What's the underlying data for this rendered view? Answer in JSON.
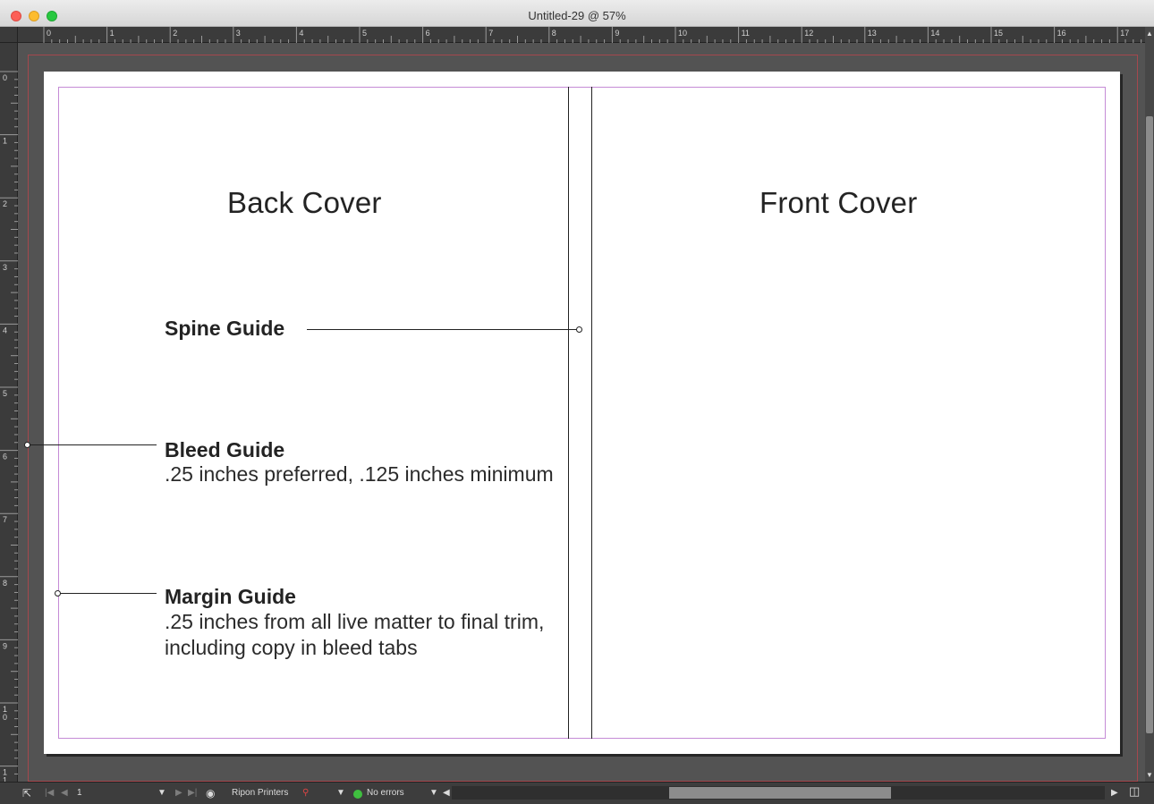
{
  "window": {
    "title": "Untitled-29 @ 57%"
  },
  "rulers": {
    "horizontal_labels": [
      "0",
      "1",
      "2",
      "3",
      "4",
      "5",
      "6",
      "7",
      "8",
      "9",
      "10",
      "11",
      "12",
      "13",
      "14",
      "15",
      "16",
      "17"
    ],
    "vertical_labels": [
      "0",
      "1",
      "2",
      "3",
      "4",
      "5",
      "6",
      "7",
      "8",
      "9",
      "1\n0",
      "1\n1"
    ]
  },
  "document": {
    "back_cover_title": "Back Cover",
    "front_cover_title": "Front Cover",
    "spine_guide": {
      "heading": "Spine Guide"
    },
    "bleed_guide": {
      "heading": "Bleed Guide",
      "body": ".25 inches preferred, .125 inches minimum"
    },
    "margin_guide": {
      "heading": "Margin Guide",
      "body": ".25 inches from all live matter to final trim, including copy in bleed tabs"
    }
  },
  "statusbar": {
    "page_number": "1",
    "preflight_profile": "Ripon Printers",
    "errors_text": "No errors"
  },
  "colors": {
    "bleed_guide": "#b4474c",
    "margin_guide": "#c58bd6",
    "status_ok": "#3fbf3f"
  }
}
